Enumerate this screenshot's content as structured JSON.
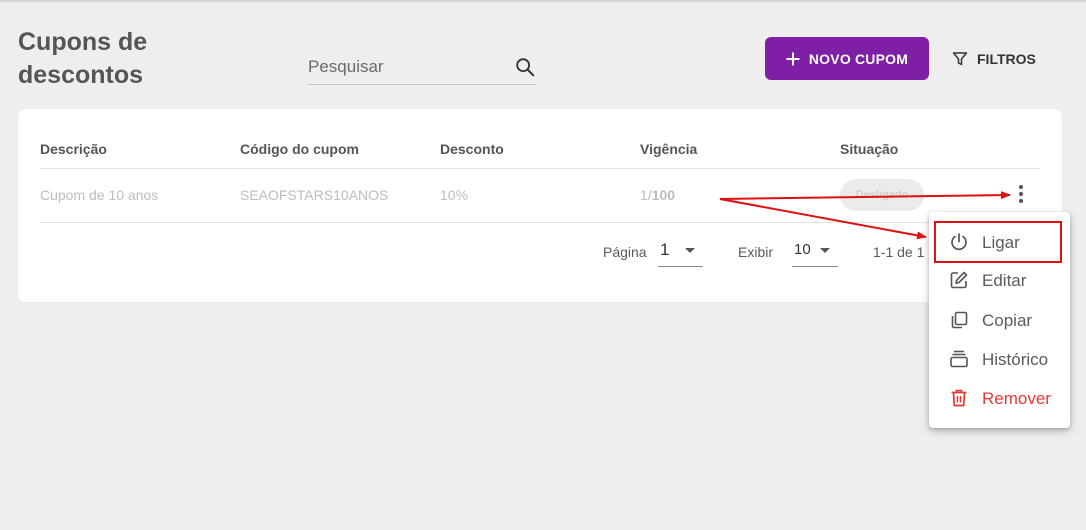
{
  "header": {
    "title": "Cupons de descontos",
    "search_placeholder": "Pesquisar",
    "new_button_label": "NOVO CUPOM",
    "filter_button_label": "FILTROS"
  },
  "table": {
    "columns": [
      "Descrição",
      "Código do cupom",
      "Desconto",
      "Vigência",
      "Situação"
    ],
    "rows": [
      {
        "description": "Cupom de 10 anos",
        "code": "SEAOFSTARS10ANOS",
        "discount": "10%",
        "validity_used": "1/",
        "validity_total": "100",
        "status": "Desligado"
      }
    ]
  },
  "pagination": {
    "page_label": "Página",
    "page_value": "1",
    "show_label": "Exibir",
    "show_value": "10",
    "range_text": "1-1 de 1"
  },
  "context_menu": {
    "items": [
      {
        "label": "Ligar",
        "icon": "power-icon"
      },
      {
        "label": "Editar",
        "icon": "edit-icon"
      },
      {
        "label": "Copiar",
        "icon": "copy-icon"
      },
      {
        "label": "Histórico",
        "icon": "history-icon"
      },
      {
        "label": "Remover",
        "icon": "trash-icon"
      }
    ]
  },
  "colors": {
    "accent": "#7e1fa6",
    "danger": "#e53935",
    "annotation": "#e01010"
  }
}
